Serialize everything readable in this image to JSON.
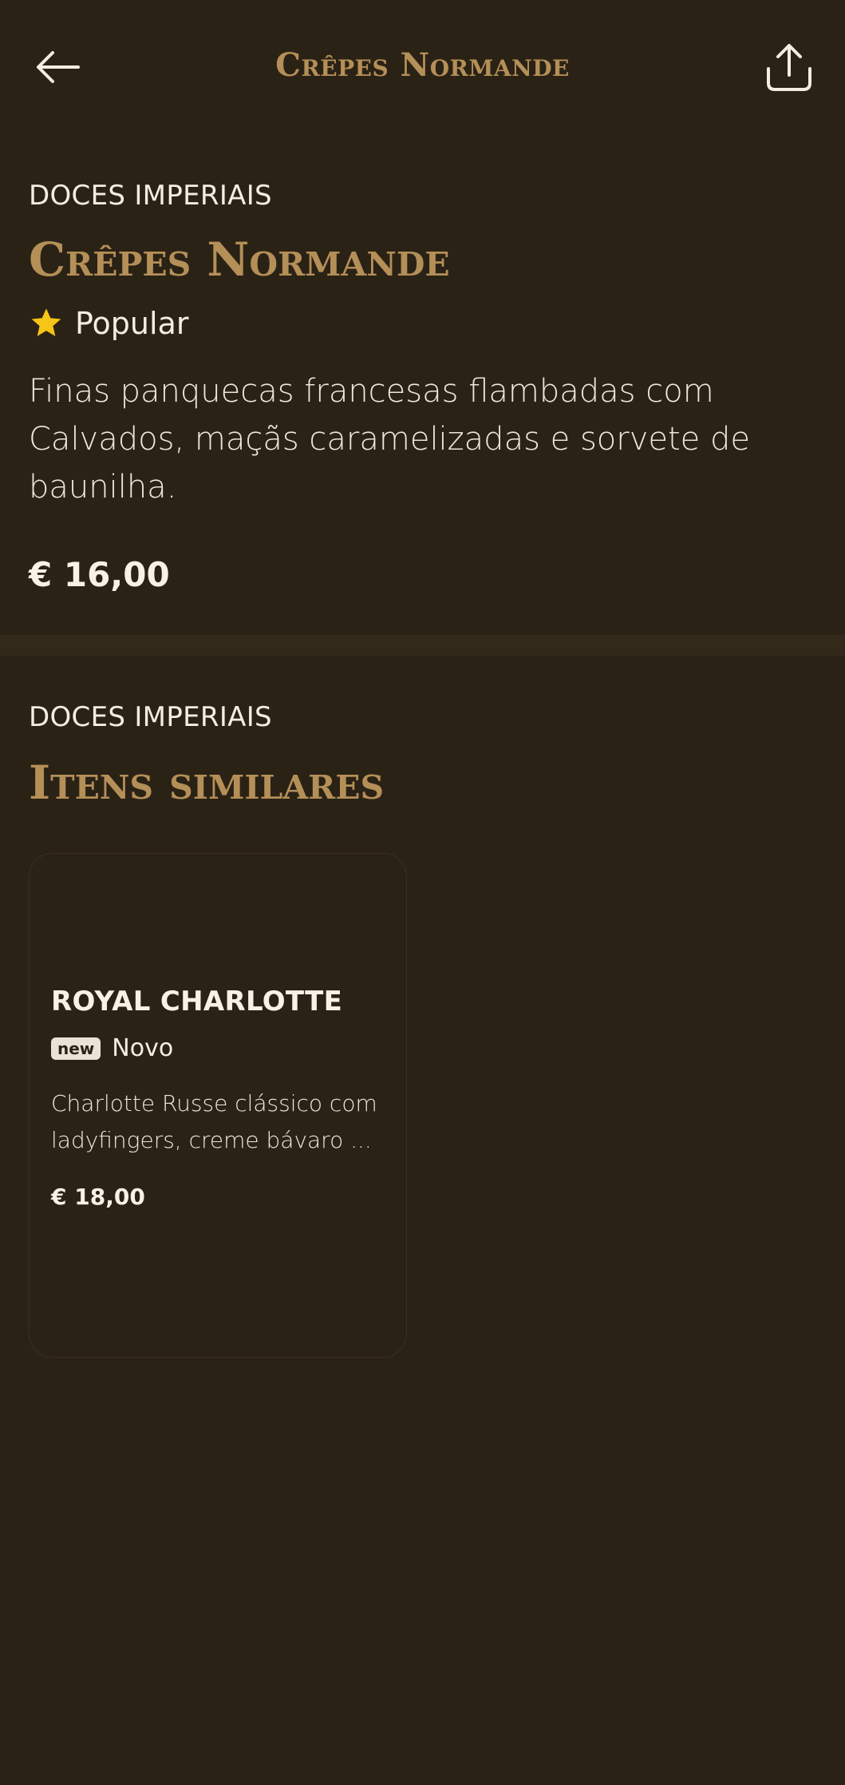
{
  "header": {
    "title": "Crêpes Normande",
    "back_icon": "arrow-left-icon",
    "share_icon": "share-icon"
  },
  "item": {
    "category": "DOCES IMPERIAIS",
    "title": "Crêpes Normande",
    "badge": "Popular",
    "badge_icon": "star-icon",
    "description": "Finas panquecas francesas flambadas com Calvados, maçãs caramelizadas e sorvete de baunilha.",
    "price": "€ 16,00"
  },
  "similar": {
    "category": "DOCES IMPERIAIS",
    "title": "Itens similares",
    "items": [
      {
        "name": "ROYAL CHARLOTTE",
        "badge_tag": "new",
        "badge_label": "Novo",
        "description": "Charlotte Russe clássico com ladyfingers, creme bávaro ...",
        "price": "€ 18,00"
      }
    ]
  },
  "colors": {
    "background": "#2b2216",
    "accent_gold": "#b48f57",
    "star": "#f5c518",
    "text": "#f4ede0"
  }
}
